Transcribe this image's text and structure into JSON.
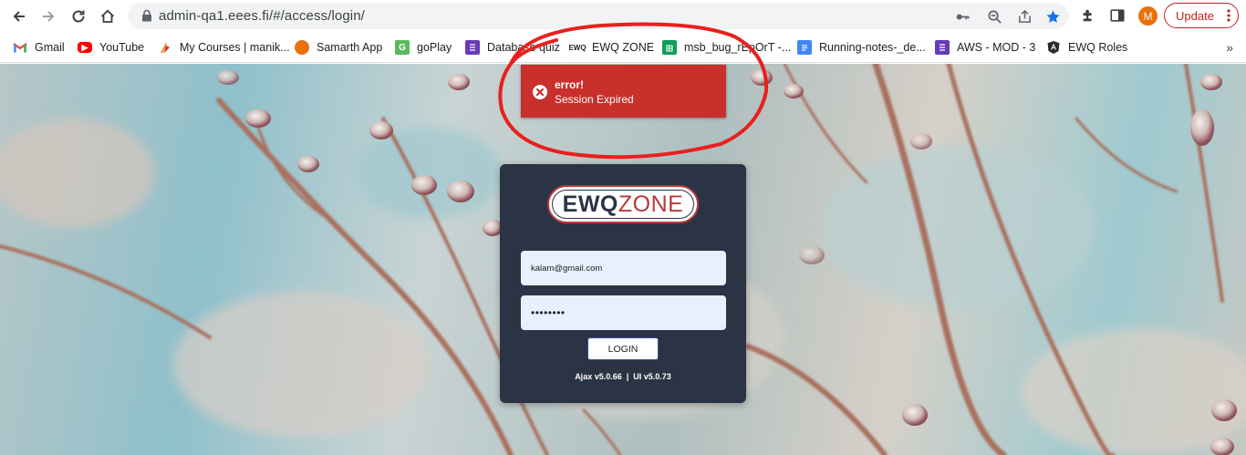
{
  "browser": {
    "url": "admin-qa1.eees.fi/#/access/login/",
    "avatar_letter": "M",
    "update_label": "Update"
  },
  "bookmarks": [
    {
      "label": "Gmail",
      "icon": "gmail-icon"
    },
    {
      "label": "YouTube",
      "icon": "youtube-icon"
    },
    {
      "label": "My Courses | manik...",
      "icon": "courses-icon"
    },
    {
      "label": "Samarth App",
      "icon": "samarth-icon"
    },
    {
      "label": "goPlay",
      "icon": "goplay-icon"
    },
    {
      "label": "Database quiz",
      "icon": "forms-icon"
    },
    {
      "label": "EWQ ZONE",
      "icon": "ewq-icon"
    },
    {
      "label": "msb_bug_rEpOrT -...",
      "icon": "sheets-icon"
    },
    {
      "label": "Running-notes-_de...",
      "icon": "docs-icon"
    },
    {
      "label": "AWS - MOD - 3",
      "icon": "forms-icon"
    },
    {
      "label": "EWQ Roles",
      "icon": "angular-icon"
    }
  ],
  "toast": {
    "title": "error!",
    "message": "Session Expired",
    "color": "#c9302c"
  },
  "login": {
    "logo_ewq": "EWQ",
    "logo_zone": "ZONE",
    "email_value": "kalam@gmail.com",
    "password_value": "••••••••",
    "button_label": "LOGIN",
    "version_ajax": "Ajax v5.0.66",
    "version_sep": "|",
    "version_ui": "UI v5.0.73",
    "card_color": "#2b3445",
    "brand_red": "#b53a3a"
  }
}
